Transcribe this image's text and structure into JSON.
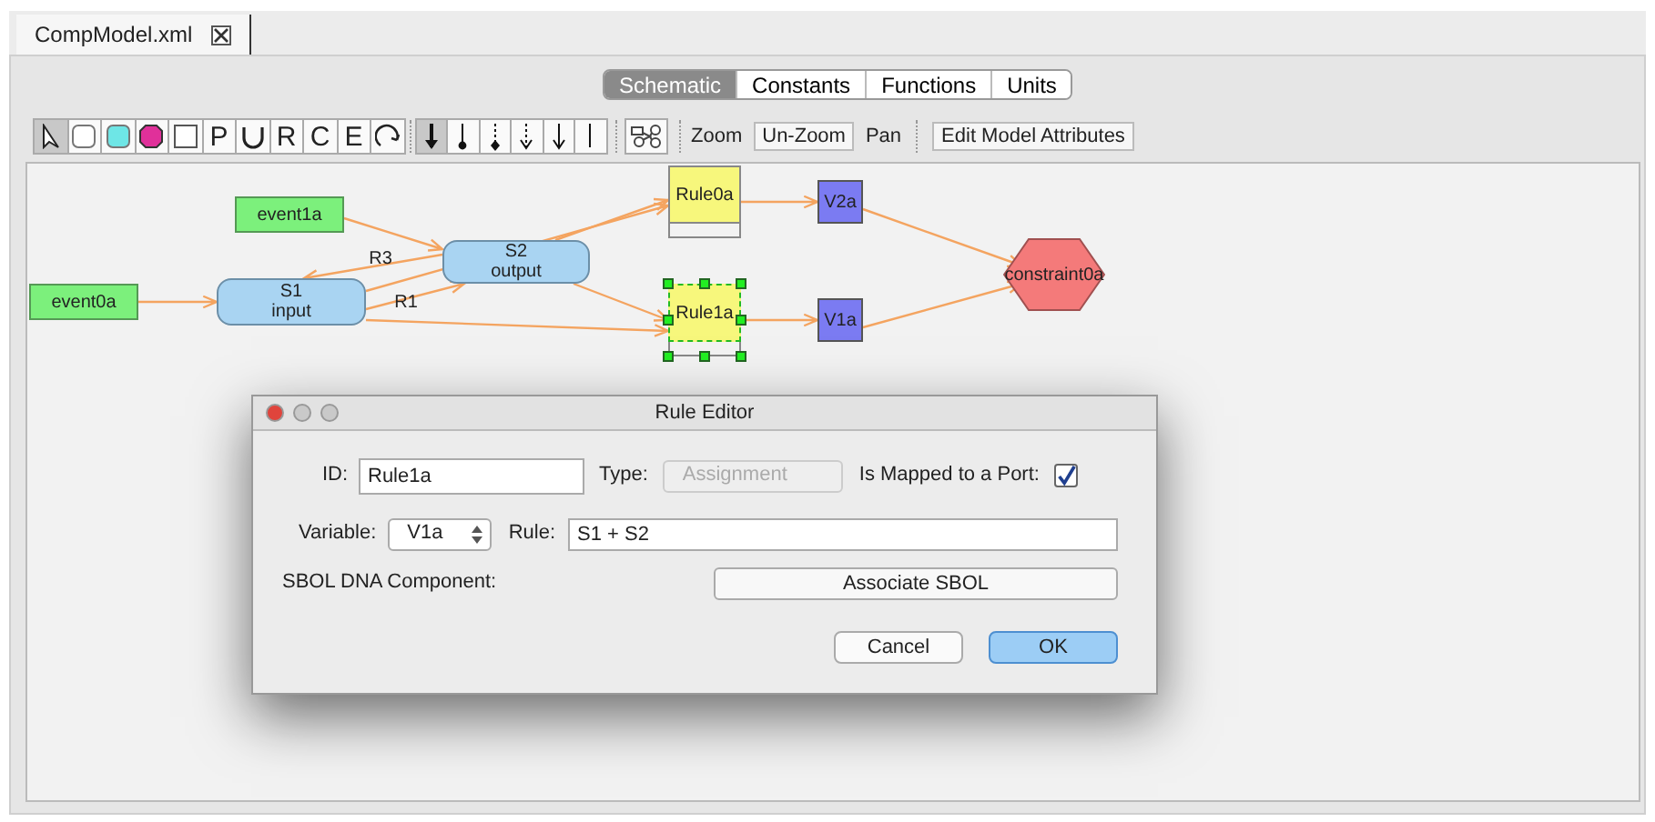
{
  "document_tab": {
    "title": "CompModel.xml"
  },
  "view_tabs": [
    {
      "label": "Schematic",
      "selected": true
    },
    {
      "label": "Constants",
      "selected": false
    },
    {
      "label": "Functions",
      "selected": false
    },
    {
      "label": "Units",
      "selected": false
    }
  ],
  "toolbar": {
    "tools": [
      {
        "kind": "pointer",
        "selected": true
      },
      {
        "kind": "plain-round-box",
        "selected": false
      },
      {
        "kind": "round-box",
        "color": "#6ee6e6",
        "selected": false
      },
      {
        "kind": "octagon",
        "color": "#e0309a",
        "selected": false
      },
      {
        "kind": "square",
        "selected": false
      },
      {
        "kind": "letter",
        "label": "P",
        "selected": false
      },
      {
        "kind": "cup",
        "selected": false
      },
      {
        "kind": "letter",
        "label": "R",
        "selected": false
      },
      {
        "kind": "letter",
        "label": "C",
        "selected": false
      },
      {
        "kind": "letter",
        "label": "E",
        "selected": false
      },
      {
        "kind": "loop",
        "selected": false
      }
    ],
    "connectors": [
      {
        "kind": "bold-arrow",
        "selected": true
      },
      {
        "kind": "ball",
        "selected": false
      },
      {
        "kind": "diamond",
        "selected": false
      },
      {
        "kind": "dotted-arrow",
        "selected": false
      },
      {
        "kind": "arrow",
        "selected": false
      },
      {
        "kind": "line",
        "selected": false
      }
    ],
    "zoom_label": "Zoom",
    "unzoom_button": "Un-Zoom",
    "pan_label": "Pan",
    "edit_attributes_button": "Edit Model Attributes"
  },
  "diagram": {
    "nodes": [
      {
        "kind": "event",
        "label": "event1a",
        "selected": false
      },
      {
        "kind": "species",
        "label": "S2",
        "sublabel": "output",
        "selected": false
      },
      {
        "kind": "event",
        "label": "event0a",
        "selected": false
      },
      {
        "kind": "species",
        "label": "S1",
        "sublabel": "input",
        "selected": false
      },
      {
        "kind": "rule",
        "label": "Rule0a",
        "selected": false
      },
      {
        "kind": "variable",
        "label": "V2a",
        "selected": false
      },
      {
        "kind": "rule",
        "label": "Rule1a",
        "selected": true
      },
      {
        "kind": "variable",
        "label": "V1a",
        "selected": false
      },
      {
        "kind": "constraint",
        "label": "constraint0a",
        "selected": false
      }
    ],
    "reaction_labels": [
      "R3",
      "R1"
    ]
  },
  "dialog": {
    "title": "Rule Editor",
    "id_label": "ID:",
    "id_value": "Rule1a",
    "type_label": "Type:",
    "type_value": "Assignment",
    "type_disabled": true,
    "port_label": "Is Mapped to a Port:",
    "port_checked": true,
    "variable_label": "Variable:",
    "variable_value": "V1a",
    "rule_label": "Rule:",
    "rule_value": "S1 + S2",
    "sbol_label": "SBOL DNA Component:",
    "sbol_button": "Associate SBOL",
    "buttons": [
      {
        "label": "Cancel",
        "default": false
      },
      {
        "label": "OK",
        "default": true
      }
    ]
  }
}
